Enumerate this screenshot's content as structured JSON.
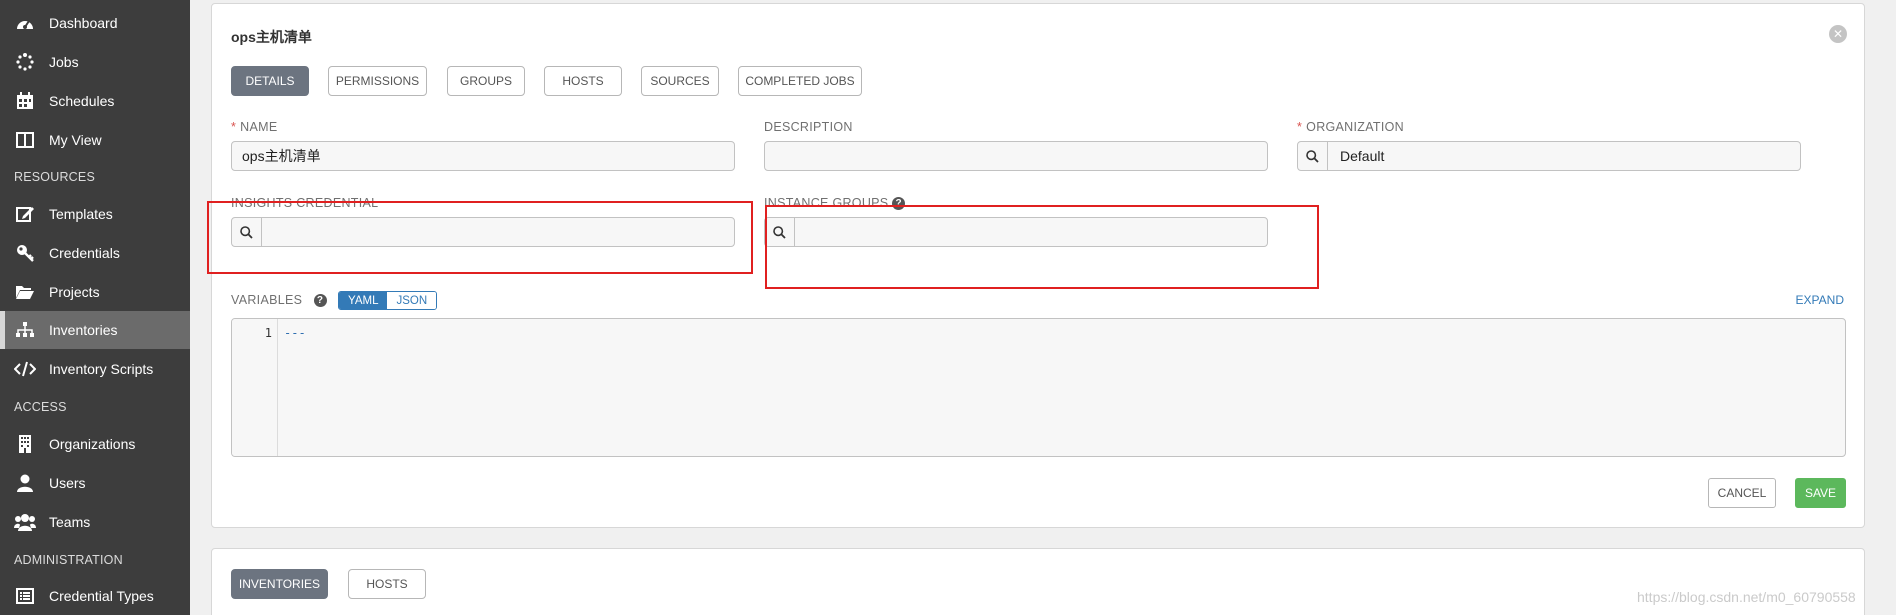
{
  "sidebar": {
    "items": [
      {
        "label": "Dashboard",
        "icon": "dashboard-icon"
      },
      {
        "label": "Jobs",
        "icon": "spinner-icon"
      },
      {
        "label": "Schedules",
        "icon": "calendar-icon"
      },
      {
        "label": "My View",
        "icon": "columns-icon"
      },
      {
        "label": "Templates",
        "icon": "edit-icon"
      },
      {
        "label": "Credentials",
        "icon": "key-icon"
      },
      {
        "label": "Projects",
        "icon": "folder-icon"
      },
      {
        "label": "Inventories",
        "icon": "sitemap-icon"
      },
      {
        "label": "Inventory Scripts",
        "icon": "code-icon"
      },
      {
        "label": "Organizations",
        "icon": "building-icon"
      },
      {
        "label": "Users",
        "icon": "user-icon"
      },
      {
        "label": "Teams",
        "icon": "users-icon"
      },
      {
        "label": "Credential Types",
        "icon": "list-alt-icon"
      }
    ],
    "sections": {
      "resources": "RESOURCES",
      "access": "ACCESS",
      "administration": "ADMINISTRATION"
    },
    "active": "Inventories"
  },
  "form": {
    "title": "ops主机清单",
    "tabs": [
      "DETAILS",
      "PERMISSIONS",
      "GROUPS",
      "HOSTS",
      "SOURCES",
      "COMPLETED JOBS"
    ],
    "active_tab": "DETAILS",
    "name_label": "NAME",
    "name_value": "ops主机清单",
    "description_label": "DESCRIPTION",
    "description_value": "",
    "organization_label": "ORGANIZATION",
    "organization_value": "Default",
    "insights_label": "INSIGHTS CREDENTIAL",
    "insights_value": "",
    "instance_groups_label": "INSTANCE GROUPS",
    "instance_groups_value": "",
    "variables_label": "VARIABLES",
    "toggle_yaml": "YAML",
    "toggle_json": "JSON",
    "toggle_selected": "YAML",
    "expand_label": "EXPAND",
    "editor_line_number": "1",
    "editor_code": "---",
    "cancel_label": "CANCEL",
    "save_label": "SAVE"
  },
  "bottom_panel": {
    "tabs": [
      "INVENTORIES",
      "HOSTS"
    ],
    "active_tab": "INVENTORIES"
  },
  "watermark": "https://blog.csdn.net/m0_60790558",
  "colors": {
    "sidebar_bg": "#3d3d3d",
    "active_tab": "#6c7480",
    "save": "#5cb85c",
    "link": "#337ab7",
    "required": "#d9534f",
    "highlight_box": "#e02020"
  }
}
